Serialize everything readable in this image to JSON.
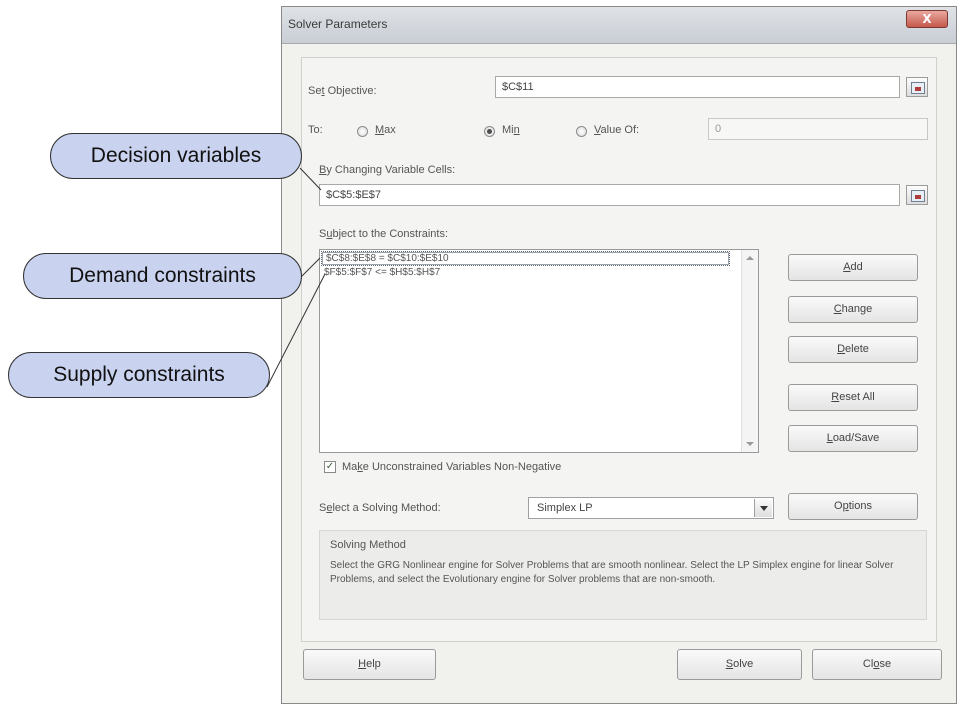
{
  "window": {
    "title": "Solver Parameters",
    "close_label": "X"
  },
  "objective": {
    "label_pre": "Se",
    "label_u": "t",
    "label_post": " Objective:",
    "value": "$C$11"
  },
  "to": {
    "label": "To:",
    "max_pre": "",
    "max_u": "M",
    "max_post": "ax",
    "min_pre": "Mi",
    "min_u": "n",
    "min_post": "",
    "valueof_pre": "",
    "valueof_u": "V",
    "valueof_post": "alue Of:",
    "selected": "Min",
    "value_of_value": "0"
  },
  "changing": {
    "label_pre": "",
    "label_u": "B",
    "label_post": "y Changing Variable Cells:",
    "value": "$C$5:$E$7"
  },
  "constraints": {
    "label_pre": "S",
    "label_u": "u",
    "label_post": "bject to the Constraints:",
    "items": [
      "$C$8:$E$8 = $C$10:$E$10",
      "$F$5:$F$7 <= $H$5:$H$7"
    ]
  },
  "side_buttons": {
    "add": {
      "u": "A",
      "rest": "dd"
    },
    "change": {
      "u": "C",
      "rest": "hange"
    },
    "delete": {
      "u": "D",
      "rest": "elete"
    },
    "reset": {
      "u": "R",
      "rest": "eset All"
    },
    "loadsave": {
      "u": "L",
      "rest": "oad/Save"
    }
  },
  "nonneg": {
    "checked": true,
    "check_glyph": "✓",
    "label_pre": "Ma",
    "label_u": "k",
    "label_post": "e Unconstrained Variables Non-Negative"
  },
  "method": {
    "label_pre": "S",
    "label_u": "e",
    "label_post": "lect a Solving Method:",
    "value": "Simplex LP"
  },
  "options": {
    "pre": "O",
    "u": "p",
    "post": "tions"
  },
  "solving_method": {
    "title": "Solving Method",
    "description": "Select the GRG Nonlinear engine for Solver Problems that are smooth nonlinear. Select the LP Simplex engine for linear Solver Problems, and select the Evolutionary engine for Solver problems that are non-smooth."
  },
  "footer": {
    "help": {
      "u": "H",
      "rest": "elp"
    },
    "solve": {
      "u": "S",
      "rest": "olve"
    },
    "close": {
      "pre": "Cl",
      "u": "o",
      "post": "se"
    }
  },
  "callouts": {
    "decision": "Decision variables",
    "demand": "Demand constraints",
    "supply": "Supply constraints"
  },
  "colors": {
    "callout_fill": "#c9d2ef",
    "dialog_bg": "#f1f1ee"
  }
}
